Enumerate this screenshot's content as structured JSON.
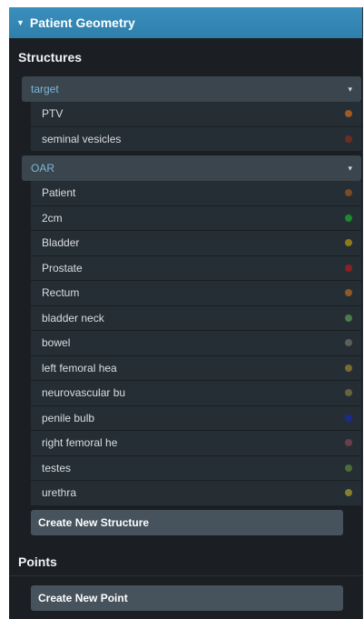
{
  "panel": {
    "title": "Patient Geometry"
  },
  "structures": {
    "title": "Structures",
    "groups": [
      {
        "label": "target",
        "items": [
          {
            "label": "PTV",
            "color": "#a05a22"
          },
          {
            "label": "seminal vesicles",
            "color": "#6a2e24"
          }
        ]
      },
      {
        "label": "OAR",
        "items": [
          {
            "label": "Patient",
            "color": "#7a4b26"
          },
          {
            "label": "2cm",
            "color": "#1e8a2a"
          },
          {
            "label": "Bladder",
            "color": "#8d7a1e"
          },
          {
            "label": "Prostate",
            "color": "#8a2222"
          },
          {
            "label": "Rectum",
            "color": "#8c5a22"
          },
          {
            "label": "bladder neck",
            "color": "#4c7a4c"
          },
          {
            "label": "bowel",
            "color": "#5a5f5a"
          },
          {
            "label": "left femoral hea",
            "color": "#7a6a32"
          },
          {
            "label": "neurovascular bu",
            "color": "#66633e"
          },
          {
            "label": "penile bulb",
            "color": "#1c2a8c"
          },
          {
            "label": "right femoral he",
            "color": "#6a3e4a"
          },
          {
            "label": "testes",
            "color": "#4a6e3a"
          },
          {
            "label": "urethra",
            "color": "#86802e"
          }
        ]
      }
    ],
    "create_button": "Create New Structure"
  },
  "points": {
    "title": "Points",
    "create_button": "Create New Point"
  }
}
